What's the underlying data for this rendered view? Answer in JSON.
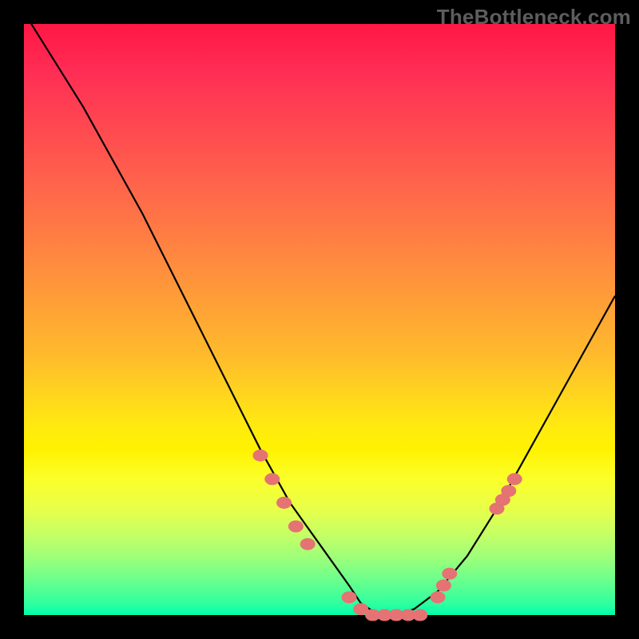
{
  "watermark": {
    "text": "TheBottleneck.com"
  },
  "colors": {
    "curve_stroke": "#000000",
    "marker_fill": "#e57373",
    "marker_stroke": "#e57373",
    "frame": "#000000"
  },
  "chart_data": {
    "type": "line",
    "title": "",
    "xlabel": "",
    "ylabel": "",
    "xlim": [
      0,
      100
    ],
    "ylim": [
      0,
      100
    ],
    "grid": false,
    "legend": "none",
    "series": [
      {
        "name": "bottleneck-curve",
        "x": [
          0,
          5,
          10,
          15,
          20,
          25,
          30,
          35,
          40,
          45,
          50,
          55,
          57,
          60,
          63,
          66,
          70,
          75,
          80,
          85,
          90,
          95,
          100
        ],
        "y": [
          102,
          94,
          86,
          77,
          68,
          58,
          48,
          38,
          28,
          19,
          12,
          5,
          2,
          0,
          0,
          1,
          4,
          10,
          18,
          27,
          36,
          45,
          54
        ]
      }
    ],
    "markers": [
      {
        "x": 40,
        "y": 27
      },
      {
        "x": 42,
        "y": 23
      },
      {
        "x": 44,
        "y": 19
      },
      {
        "x": 46,
        "y": 15
      },
      {
        "x": 48,
        "y": 12
      },
      {
        "x": 55,
        "y": 3
      },
      {
        "x": 57,
        "y": 1
      },
      {
        "x": 59,
        "y": 0
      },
      {
        "x": 61,
        "y": 0
      },
      {
        "x": 63,
        "y": 0
      },
      {
        "x": 65,
        "y": 0
      },
      {
        "x": 67,
        "y": 0
      },
      {
        "x": 70,
        "y": 3
      },
      {
        "x": 71,
        "y": 5
      },
      {
        "x": 72,
        "y": 7
      },
      {
        "x": 80,
        "y": 18
      },
      {
        "x": 81,
        "y": 19.5
      },
      {
        "x": 82,
        "y": 21
      },
      {
        "x": 83,
        "y": 23
      }
    ],
    "annotations": []
  }
}
